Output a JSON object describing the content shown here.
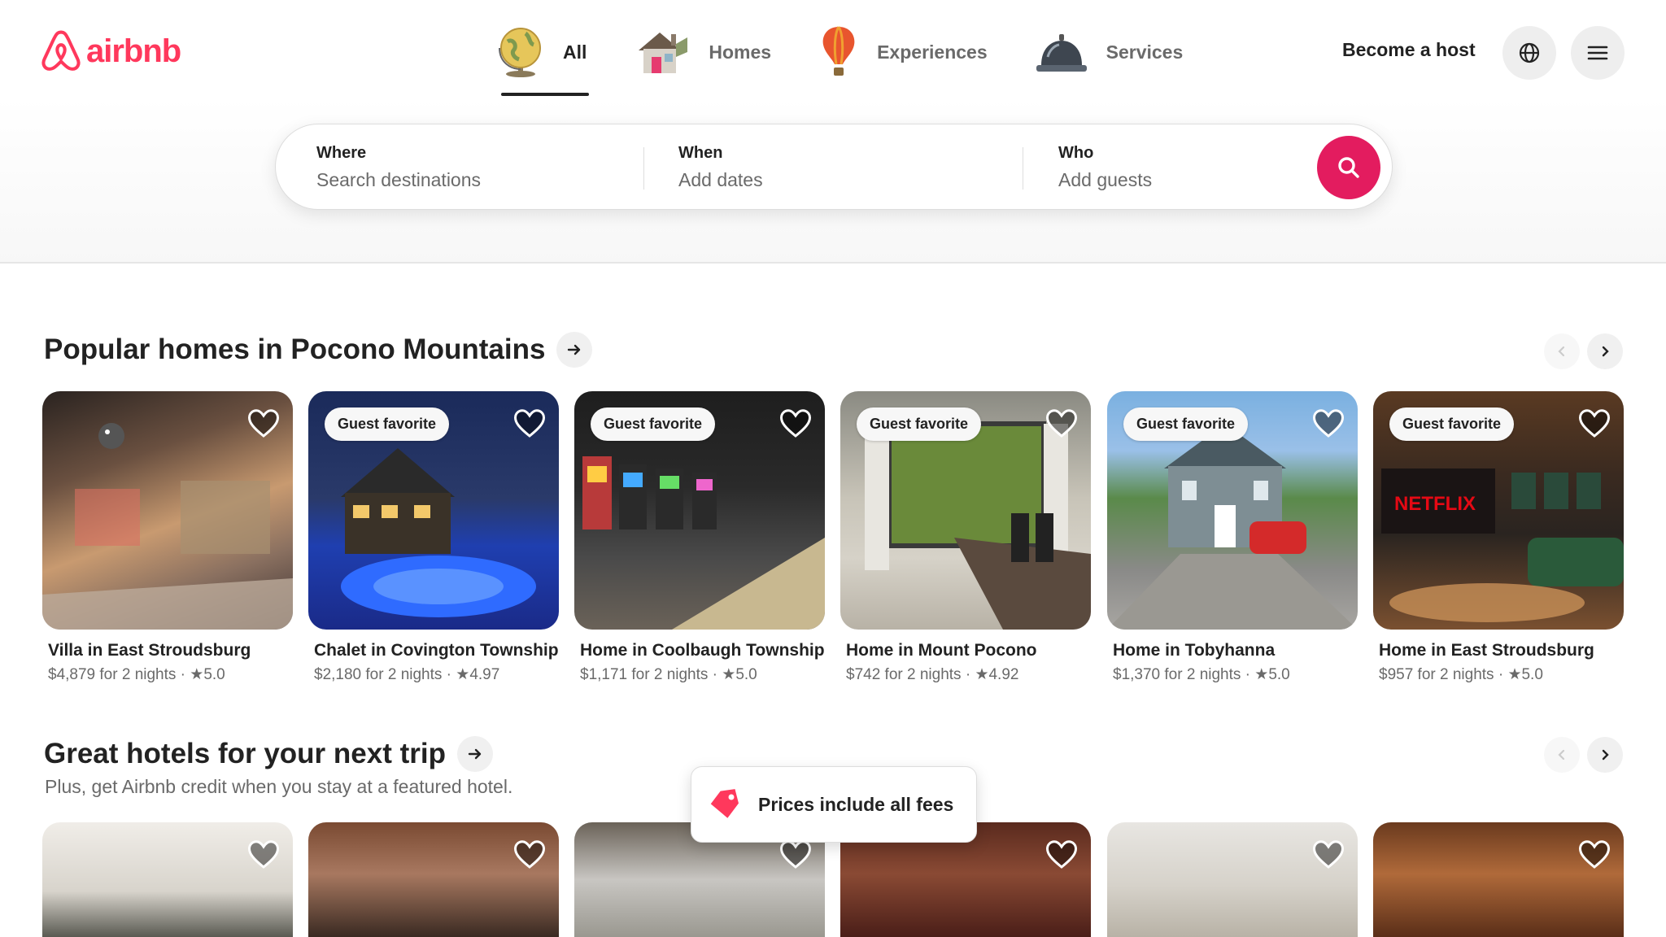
{
  "brand": {
    "name": "airbnb",
    "color": "#ff385c"
  },
  "categories": [
    {
      "label": "All",
      "icon": "globe-icon",
      "active": true
    },
    {
      "label": "Homes",
      "icon": "house-icon",
      "active": false
    },
    {
      "label": "Experiences",
      "icon": "hot-air-balloon-icon",
      "active": false
    },
    {
      "label": "Services",
      "icon": "service-bell-icon",
      "active": false
    }
  ],
  "header": {
    "host_link": "Become a host",
    "language_icon": "globe-outline-icon",
    "menu_icon": "hamburger-menu-icon"
  },
  "search": {
    "where_title": "Where",
    "where_placeholder": "Search destinations",
    "when_title": "When",
    "when_placeholder": "Add dates",
    "who_title": "Who",
    "who_placeholder": "Add guests",
    "button_icon": "search-icon",
    "button_color": "#e31c5f"
  },
  "popular": {
    "title": "Popular homes in Pocono Mountains",
    "listings": [
      {
        "title": "Villa in East Stroudsburg",
        "price": "$4,879 for 2 nights",
        "rating": "5.0",
        "badge": ""
      },
      {
        "title": "Chalet in Covington Township",
        "price": "$2,180 for 2 nights",
        "rating": "4.97",
        "badge": "Guest favorite"
      },
      {
        "title": "Home in Coolbaugh Township",
        "price": "$1,171 for 2 nights",
        "rating": "5.0",
        "badge": "Guest favorite"
      },
      {
        "title": "Home in Mount Pocono",
        "price": "$742 for 2 nights",
        "rating": "4.92",
        "badge": "Guest favorite"
      },
      {
        "title": "Home in Tobyhanna",
        "price": "$1,370 for 2 nights",
        "rating": "5.0",
        "badge": "Guest favorite"
      },
      {
        "title": "Home in East Stroudsburg",
        "price": "$957 for 2 nights",
        "rating": "5.0",
        "badge": "Guest favorite"
      }
    ]
  },
  "hotels": {
    "title": "Great hotels for your next trip",
    "subtitle": "Plus, get Airbnb credit when you stay at a featured hotel.",
    "count": 6
  },
  "toast": {
    "text": "Prices include all fees",
    "icon": "price-tag-icon"
  }
}
